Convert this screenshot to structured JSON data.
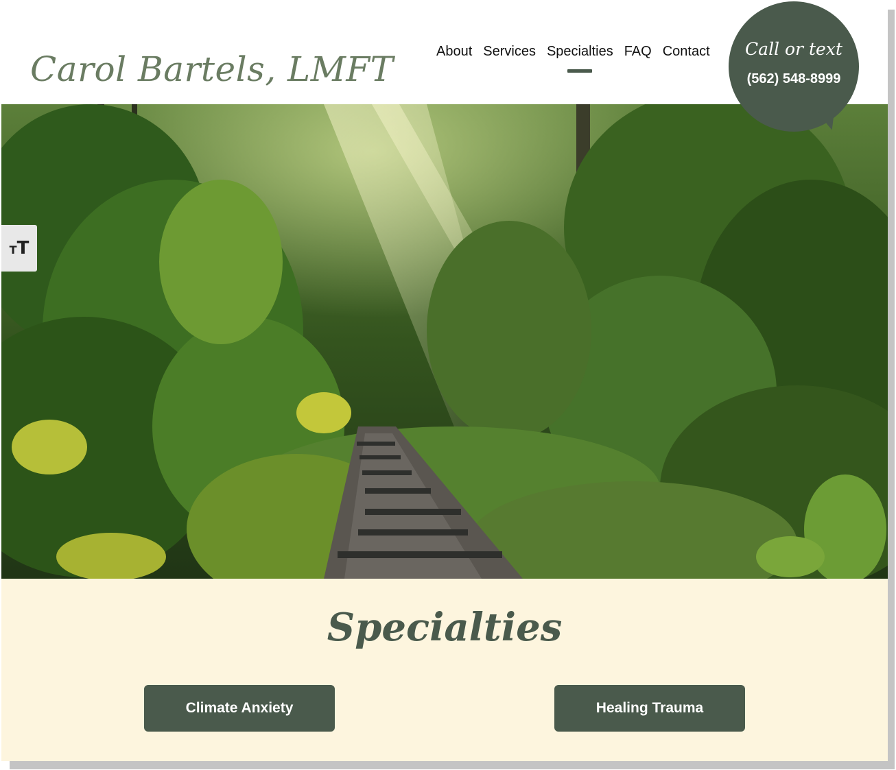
{
  "site": {
    "logo_text": "Carol Bartels, LMFT"
  },
  "nav": {
    "items": [
      {
        "label": "About"
      },
      {
        "label": "Services"
      },
      {
        "label": "Specialties",
        "active": true
      },
      {
        "label": "FAQ"
      },
      {
        "label": "Contact"
      }
    ]
  },
  "callout": {
    "line1": "Call or text",
    "phone": "(562) 548-8999"
  },
  "hero": {
    "image": "forest-path-image"
  },
  "accessibility": {
    "text_size_label": "ᴛT",
    "icon": "text-size-icon"
  },
  "specialties": {
    "title": "Specialties",
    "buttons": [
      {
        "label": "Climate Anxiety"
      },
      {
        "label": "Healing Trauma"
      }
    ]
  },
  "colors": {
    "brand_dark_green": "#4a5a4c",
    "logo_green": "#6a7c62",
    "section_bg": "#fdf5de"
  }
}
